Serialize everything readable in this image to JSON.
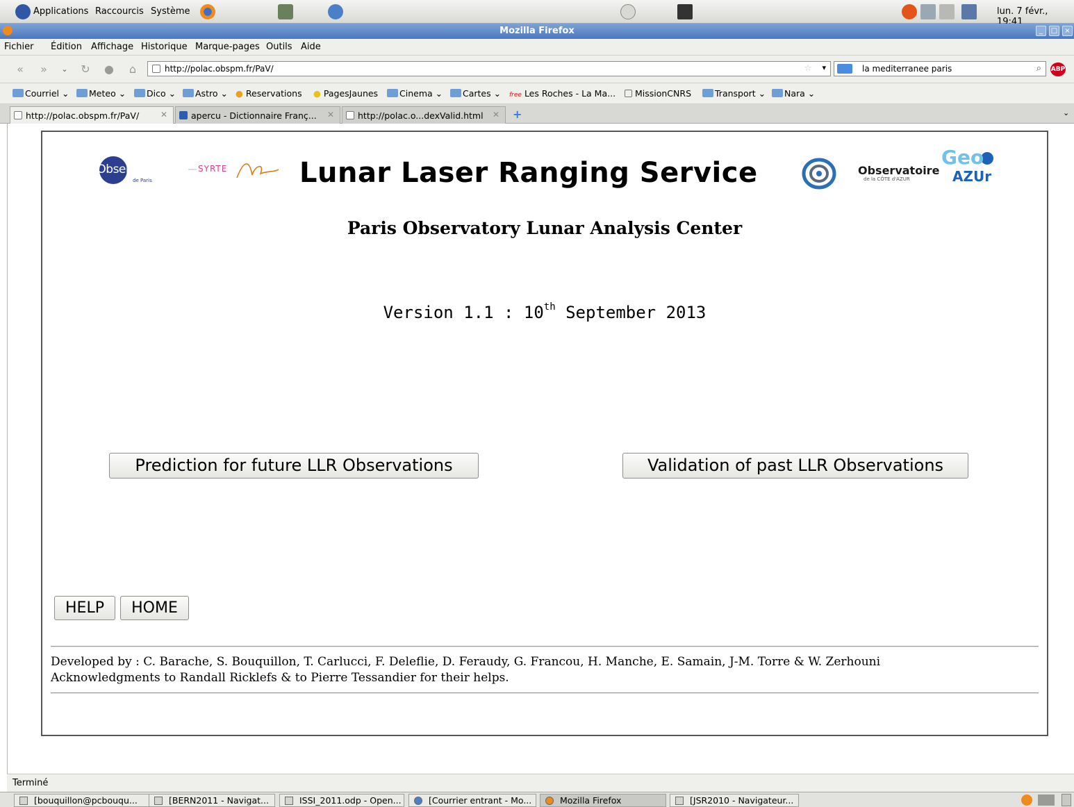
{
  "top_panel": {
    "menus": [
      "Applications",
      "Raccourcis",
      "Système"
    ],
    "clock": "lun. 7 févr., 19:41"
  },
  "window": {
    "title": "Mozilla Firefox"
  },
  "menu_bar": [
    "Fichier",
    "Édition",
    "Affichage",
    "Historique",
    "Marque-pages",
    "Outils",
    "Aide"
  ],
  "nav": {
    "url": "http://polac.obspm.fr/PaV/",
    "search": "la mediterranee paris"
  },
  "bookmarks": [
    "Courriel",
    "Meteo",
    "Dico",
    "Astro",
    "Reservations",
    "PagesJaunes",
    "Cinema",
    "Cartes",
    "Les Roches - La Ma...",
    "MissionCNRS",
    "Transport",
    "Nara"
  ],
  "tabs": [
    "http://polac.obspm.fr/PaV/",
    "apercu - Dictionnaire Franç...",
    "http://polac.o...dexValid.html"
  ],
  "page": {
    "logo_paris": "l'Observatoire",
    "logo_paris_sub": "de Paris",
    "logo_syrte": "SYRTE",
    "title": "Lunar Laser Ranging Service",
    "logo_oca": "Observatoire",
    "logo_oca_sub": "de la CÔTE d'AZUR",
    "logo_geo_top": "Geo",
    "logo_geo_bottom": "AZUr",
    "subtitle": "Paris Observatory Lunar Analysis Center",
    "version_prefix": "Version 1.1 : 10",
    "version_sup": "th",
    "version_suffix": " September 2013",
    "prediction_button": "Prediction for future LLR Observations",
    "validation_button": "Validation of past LLR Observations",
    "help_button": "HELP",
    "home_button": "HOME",
    "credits_line1": "Developed by : C. Barache, S. Bouquillon, T. Carlucci, F. Deleflie, D. Feraudy, G. Francou, H. Manche, E. Samain, J-M. Torre & W. Zerhouni",
    "credits_line2": "Acknowledgments to Randall Ricklefs & to Pierre Tessandier for their helps."
  },
  "status": "Terminé",
  "taskbar": [
    "[bouquillon@pcbouqu...",
    "[BERN2011 - Navigat...",
    "ISSI_2011.odp - Open...",
    "[Courrier entrant - Mo...",
    "Mozilla Firefox",
    "[JSR2010 - Navigateur..."
  ],
  "colors": {
    "title_bar": "#4a78bd",
    "logo_blue": "#2b3e8f",
    "logo_light_blue": "#4aa8d8"
  }
}
